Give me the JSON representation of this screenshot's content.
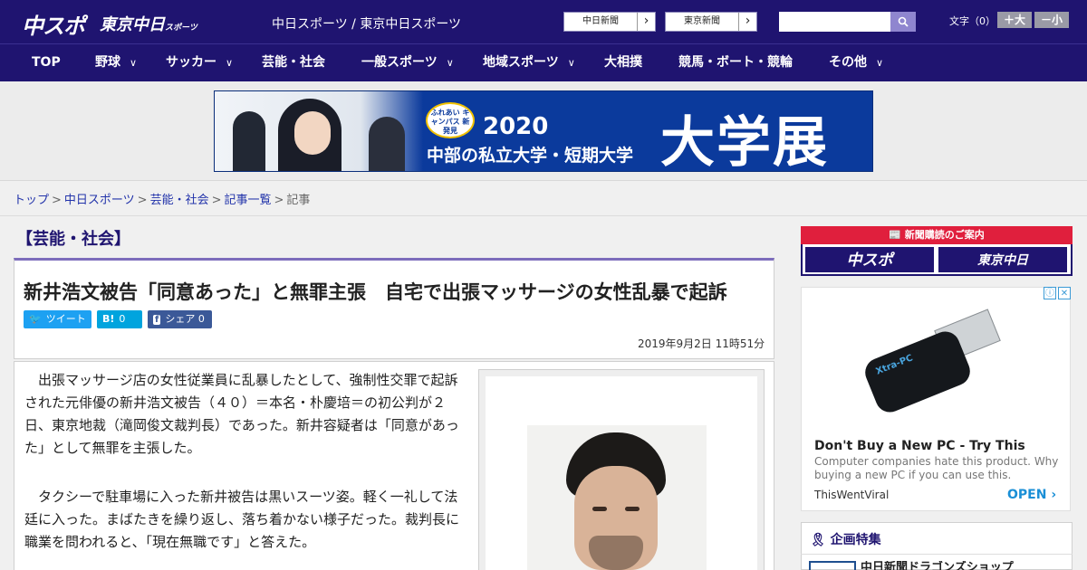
{
  "header": {
    "logo_chuspo": "中スポ",
    "logo_tokyo": "東京中日",
    "logo_tokyo_suffix": "スポーツ",
    "site_title": "中日スポーツ / 東京中日スポーツ",
    "btn_chunichi": "中日新聞",
    "btn_tokyo": "東京新聞",
    "arrow": "›",
    "search_placeholder": "",
    "fontsize_label": "文字（0）",
    "fs_larger": "＋大",
    "fs_smaller": "－小"
  },
  "nav": {
    "items": [
      {
        "label": "TOP",
        "chevron": ""
      },
      {
        "label": "野球",
        "chevron": "∨"
      },
      {
        "label": "サッカー",
        "chevron": "∨"
      },
      {
        "label": "芸能・社会",
        "chevron": ""
      },
      {
        "label": "一般スポーツ",
        "chevron": "∨"
      },
      {
        "label": "地域スポーツ",
        "chevron": "∨"
      },
      {
        "label": "大相撲",
        "chevron": ""
      },
      {
        "label": "競馬・ボート・競輪",
        "chevron": ""
      },
      {
        "label": "その他",
        "chevron": "∨"
      }
    ]
  },
  "banner": {
    "badge": "ふれあい キャンパス 新発見",
    "year": "2020",
    "subtitle": "中部の私立大学・短期大学",
    "big": "大学展"
  },
  "breadcrumb": {
    "items": [
      "トップ",
      "中日スポーツ",
      "芸能・社会",
      "記事一覧"
    ],
    "current": "記事",
    "sep": ">"
  },
  "article": {
    "section": "【芸能・社会】",
    "headline": "新井浩文被告「同意あった」と無罪主張　自宅で出張マッサージの女性乱暴で起訴",
    "share": {
      "tweet": "ツイート",
      "hatena": "0",
      "facebook": "シェア 0"
    },
    "datetime": "2019年9月2日 11時51分",
    "paragraphs": [
      "　出張マッサージ店の女性従業員に乱暴したとして、強制性交罪で起訴された元俳優の新井浩文被告（４０）＝本名・朴慶培＝の初公判が２日、東京地裁（滝岡俊文裁判長）であった。新井容疑者は「同意があった」として無罪を主張した。",
      "　タクシーで駐車場に入った新井被告は黒いスーツ姿。軽く一礼して法廷に入った。まばたきを繰り返し、落ち着かない様子だった。裁判長に職業を問われると、「現在無職です」と答えた。"
    ]
  },
  "sidebar": {
    "subscribe_head": "新聞購読のご案内",
    "sub_logo_1": "中スポ",
    "sub_logo_2": "東京中日",
    "ad": {
      "product_text": "Xtra-PC",
      "title": "Don't Buy a New PC - Try This",
      "desc": "Computer companies hate this product. Why buying a new PC if you can use this.",
      "source": "ThisWentViral",
      "cta": "OPEN ›",
      "icon_info": "ⓘ",
      "icon_close": "✕"
    },
    "feature_head": "企画特集",
    "feature_item": "中日新聞ドラゴンズショップ"
  },
  "colors": {
    "brand": "#1f1470",
    "accent_red": "#e01f3d",
    "twitter": "#1da1f2",
    "hatena": "#00a4de",
    "facebook": "#3b5998"
  }
}
